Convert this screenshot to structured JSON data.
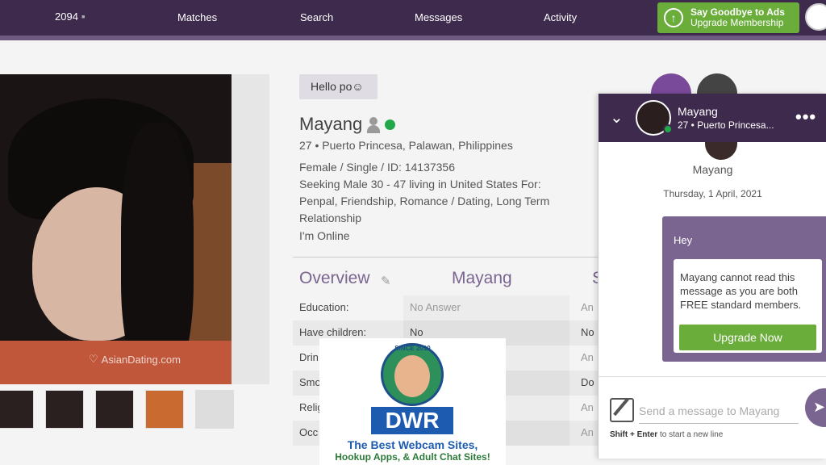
{
  "nav": {
    "count": "2094",
    "links": [
      "Matches",
      "Search",
      "Messages",
      "Activity"
    ],
    "upgrade_title": "Say Goodbye to Ads",
    "upgrade_sub": "Upgrade Membership"
  },
  "photo": {
    "watermark": "AsianDating.com"
  },
  "profile": {
    "greeting": "Hello po☺",
    "name": "Mayang",
    "location_line": "27 • Puerto Princesa, Palawan, Philippines",
    "details": "Female / Single / ID: 14137356",
    "seeking_1": "Seeking Male 30 - 47 living in United States For:",
    "seeking_2": "Penpal, Friendship, Romance / Dating, Long Term",
    "seeking_3": "Relationship",
    "status": "I'm Online"
  },
  "overview": {
    "tab_overview": "Overview",
    "tab_name": "Mayang",
    "tab_partial": "S",
    "rows": [
      {
        "label": "Education:",
        "value": "No Answer",
        "value2": "An"
      },
      {
        "label": "Have children:",
        "value": "No",
        "value2": "No"
      },
      {
        "label": "Drin",
        "value": "",
        "value2": "An"
      },
      {
        "label": "Smo",
        "value": "",
        "value2": "Do"
      },
      {
        "label": "Relig",
        "value": "",
        "value2": "An"
      },
      {
        "label": "Occ",
        "value": "",
        "value2": "An"
      }
    ]
  },
  "chat": {
    "name": "Mayang",
    "location": "27 • Puerto Princesa...",
    "more": "•••",
    "date": "Thursday, 1 April, 2021",
    "message": "Hey",
    "notice": "Mayang cannot read this message as you are both FREE standard members.",
    "upgrade_button": "Upgrade Now",
    "input_placeholder": "Send a message to Mayang",
    "hint_bold": "Shift + Enter",
    "hint_rest": " to start a new line"
  },
  "ad": {
    "since": "SINCE 2010",
    "logo": "DWR",
    "line1": "The Best Webcam Sites,",
    "line2": "Hookup Apps, & Adult Chat Sites!"
  },
  "colors": {
    "nav_bg": "#3d2a4d",
    "accent_purple": "#7a6590",
    "green": "#6aad3b",
    "online": "#22a84a"
  }
}
